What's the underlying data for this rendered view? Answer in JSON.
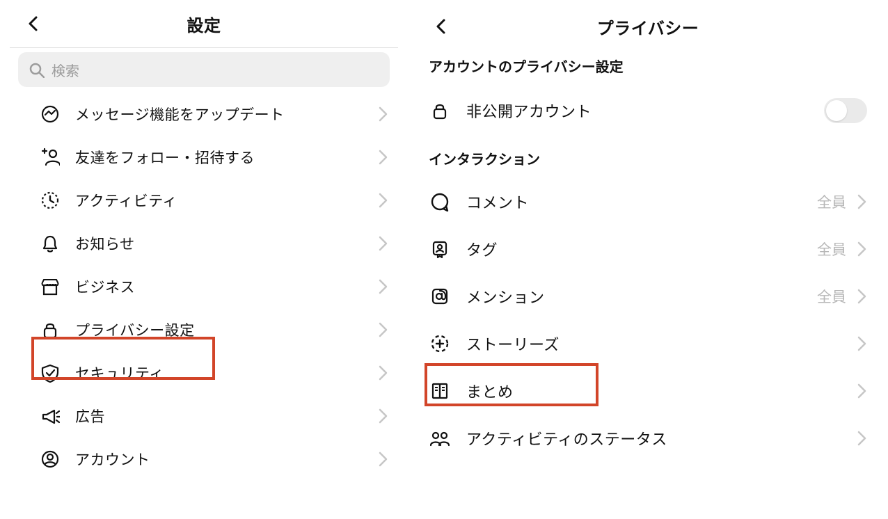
{
  "left": {
    "title": "設定",
    "search_placeholder": "検索",
    "items": [
      {
        "icon": "messenger",
        "label": "メッセージ機能をアップデート"
      },
      {
        "icon": "follow",
        "label": "友達をフォロー・招待する"
      },
      {
        "icon": "activity",
        "label": "アクティビティ"
      },
      {
        "icon": "bell",
        "label": "お知らせ"
      },
      {
        "icon": "store",
        "label": "ビジネス"
      },
      {
        "icon": "lock",
        "label": "プライバシー設定"
      },
      {
        "icon": "shield",
        "label": "セキュリティ"
      },
      {
        "icon": "megaphone",
        "label": "広告"
      },
      {
        "icon": "account",
        "label": "アカウント"
      }
    ]
  },
  "right": {
    "title": "プライバシー",
    "section1": "アカウントのプライバシー設定",
    "private_label": "非公開アカウント",
    "private_on": false,
    "section2": "インタラクション",
    "value_all": "全員",
    "items": [
      {
        "icon": "comment",
        "label": "コメント",
        "value": "全員"
      },
      {
        "icon": "tag",
        "label": "タグ",
        "value": "全員"
      },
      {
        "icon": "mention",
        "label": "メンション",
        "value": "全員"
      },
      {
        "icon": "story",
        "label": "ストーリーズ",
        "value": ""
      },
      {
        "icon": "guide",
        "label": "まとめ",
        "value": ""
      },
      {
        "icon": "status",
        "label": "アクティビティのステータス",
        "value": ""
      }
    ]
  }
}
